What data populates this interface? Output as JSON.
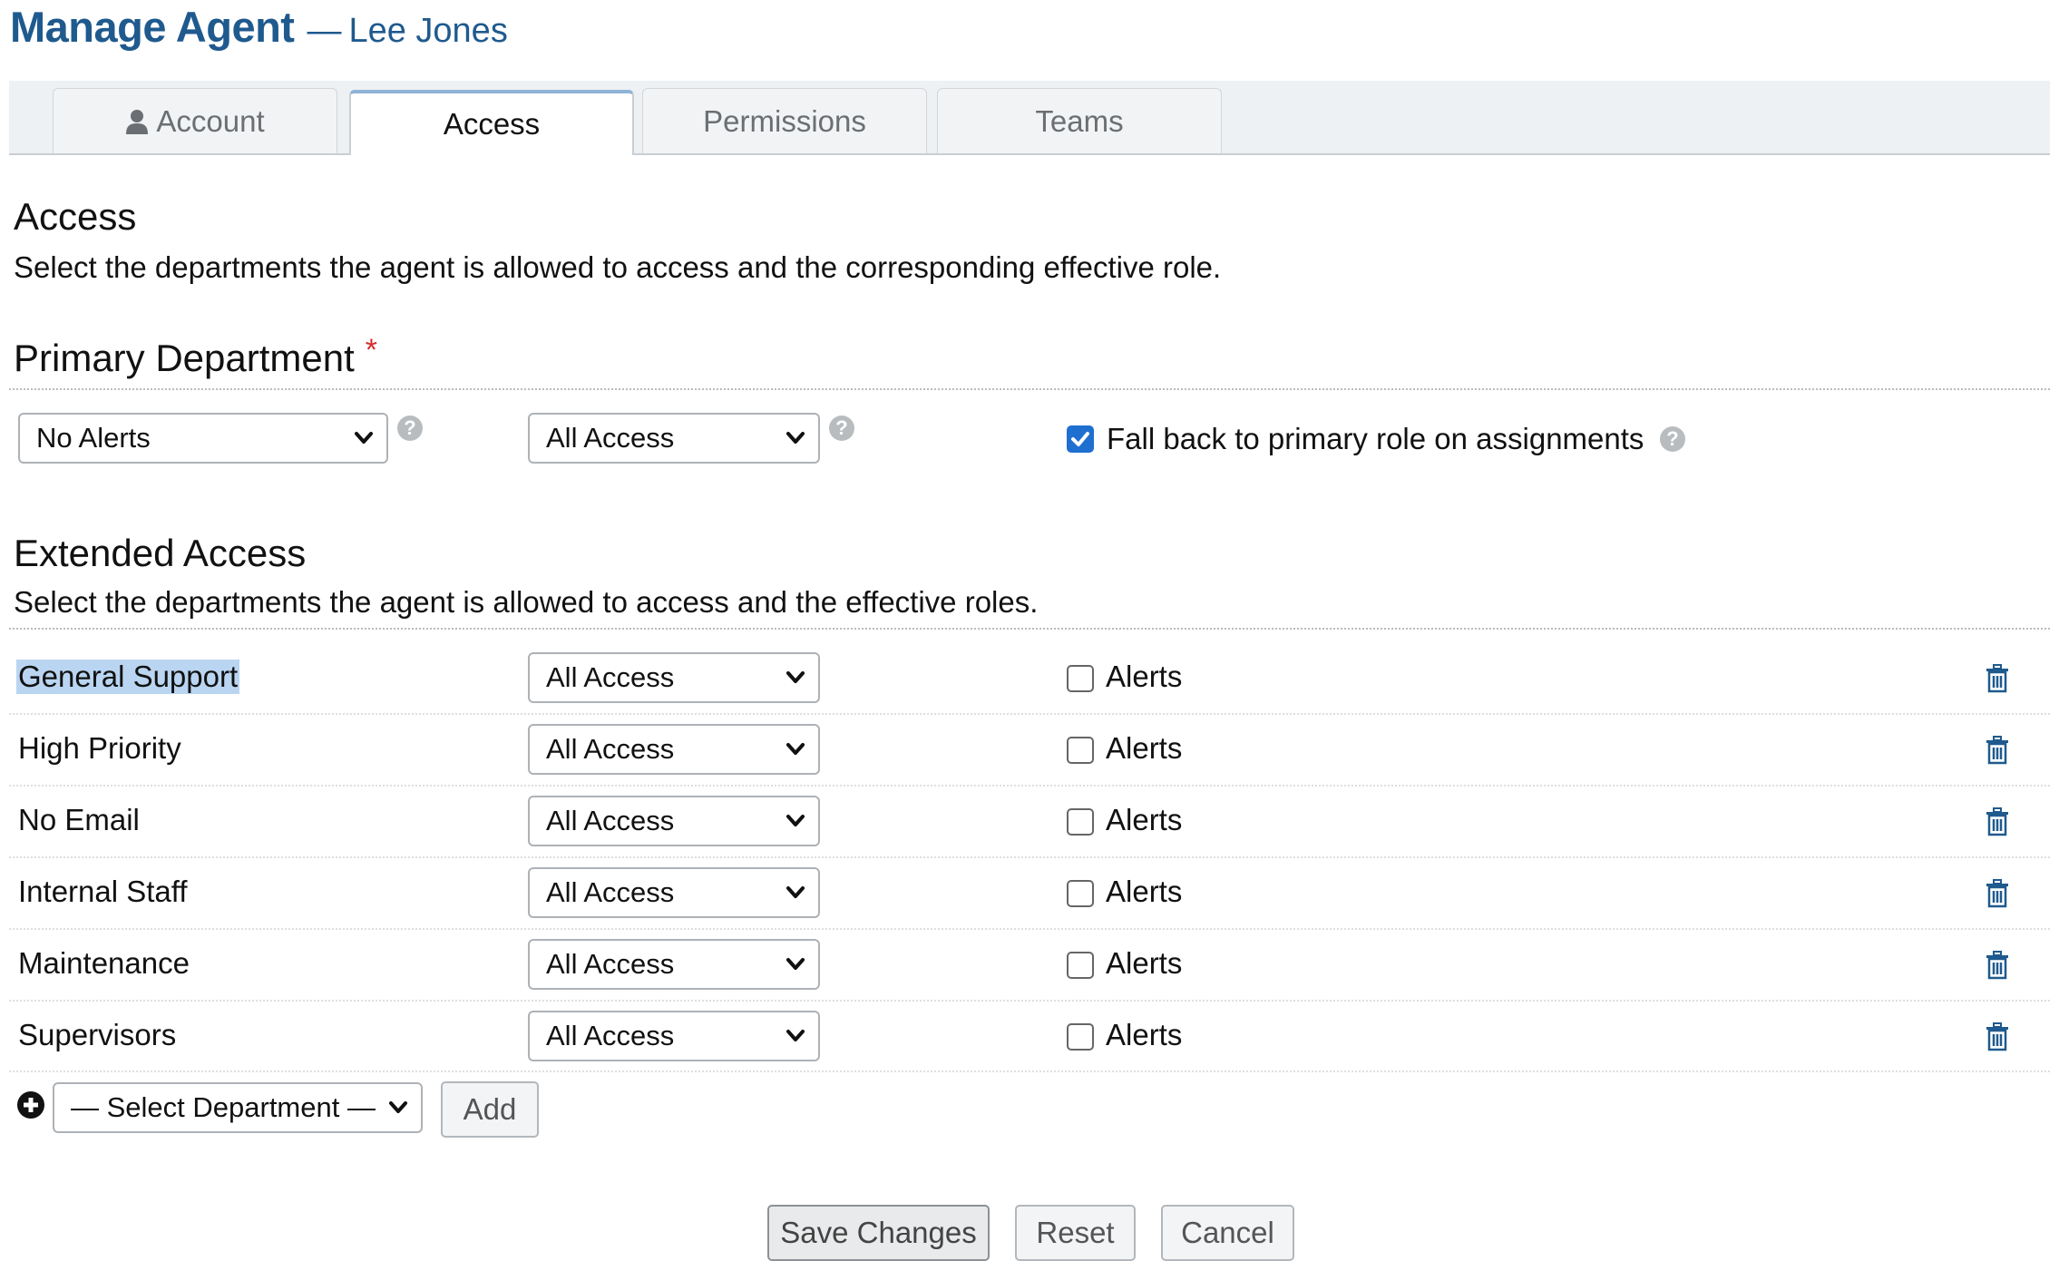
{
  "header": {
    "title": "Manage Agent",
    "separator": "—",
    "agent_name": "Lee Jones"
  },
  "tabs": [
    {
      "label": "Account",
      "icon": "user-icon",
      "active": false
    },
    {
      "label": "Access",
      "active": true
    },
    {
      "label": "Permissions",
      "active": false
    },
    {
      "label": "Teams",
      "active": false
    }
  ],
  "access": {
    "title": "Access",
    "description": "Select the departments the agent is allowed to access and the corresponding effective role."
  },
  "primary": {
    "title": "Primary Department",
    "required_mark": "*",
    "department_select": "No Alerts",
    "role_select": "All Access",
    "help_glyph": "?",
    "fallback_label": "Fall back to primary role on assignments",
    "fallback_checked": true
  },
  "extended": {
    "title": "Extended Access",
    "description": "Select the departments the agent is allowed to access and the effective roles.",
    "alerts_label": "Alerts",
    "rows": [
      {
        "department": "General Support",
        "role": "All Access",
        "alerts": false
      },
      {
        "department": "High Priority",
        "role": "All Access",
        "alerts": false
      },
      {
        "department": "No Email",
        "role": "All Access",
        "alerts": false
      },
      {
        "department": "Internal Staff",
        "role": "All Access",
        "alerts": false
      },
      {
        "department": "Maintenance",
        "role": "All Access",
        "alerts": false
      },
      {
        "department": "Supervisors",
        "role": "All Access",
        "alerts": false
      }
    ],
    "add_select": "— Select Department —",
    "add_button": "Add"
  },
  "actions": {
    "save": "Save Changes",
    "reset": "Reset",
    "cancel": "Cancel"
  },
  "colors": {
    "brand": "#1f5a8e",
    "checkbox_checked": "#1f6fd1",
    "required": "#d62d2d",
    "selection": "#b9d5f1"
  }
}
